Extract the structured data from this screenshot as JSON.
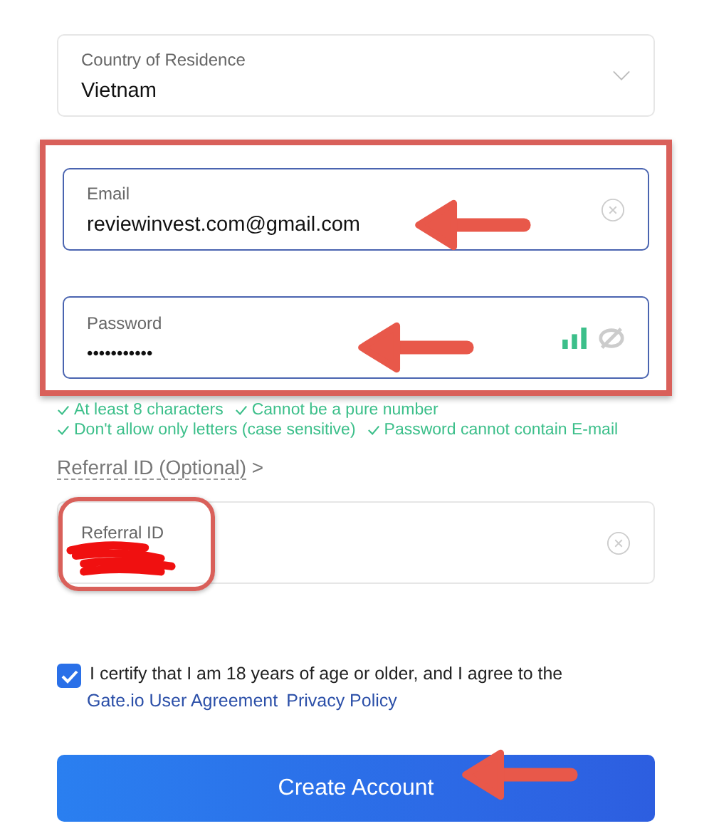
{
  "country": {
    "label": "Country of Residence",
    "value": "Vietnam"
  },
  "email": {
    "label": "Email",
    "value": "reviewinvest.com@gmail.com"
  },
  "password": {
    "label": "Password",
    "value": "•••••••••••"
  },
  "password_rules": [
    {
      "text": "At least 8 characters",
      "met": true
    },
    {
      "text": "Cannot be a pure number",
      "met": true
    },
    {
      "text": "Don't allow only letters (case sensitive)",
      "met": true
    },
    {
      "text": "Password cannot contain E-mail",
      "met": true
    }
  ],
  "referral_toggle": {
    "label": "Referral ID (Optional)",
    "chevron": ">"
  },
  "referral": {
    "label": "Referral ID"
  },
  "terms": {
    "checked": true,
    "text": "I certify that I am 18 years of age or older, and I agree to the",
    "links": [
      "Gate.io User Agreement",
      "Privacy Policy"
    ]
  },
  "submit": "Create Account"
}
